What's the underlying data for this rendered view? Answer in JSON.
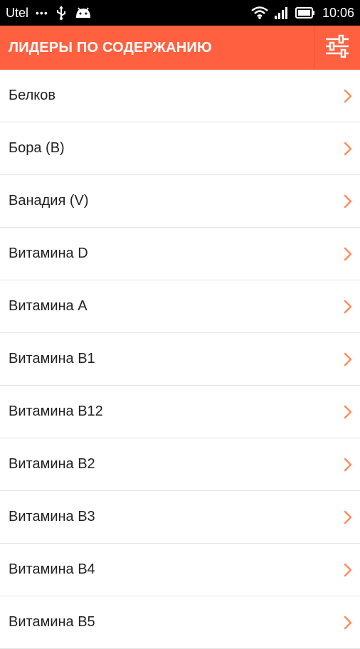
{
  "status_bar": {
    "carrier": "Utel",
    "dots": "•••",
    "time": "10:06",
    "icons": [
      "usb-icon",
      "android-icon",
      "wifi-icon",
      "signal-icon",
      "battery-icon"
    ]
  },
  "app_bar": {
    "title": "ЛИДЕРЫ ПО СОДЕРЖАНИЮ",
    "background": "#ff6140",
    "action_icon": "sliders-icon"
  },
  "list": {
    "items": [
      {
        "label": "Белков"
      },
      {
        "label": "Бора (B)"
      },
      {
        "label": "Ванадия (V)"
      },
      {
        "label": "Витамина D"
      },
      {
        "label": "Витамина А"
      },
      {
        "label": "Витамина В1"
      },
      {
        "label": "Витамина В12"
      },
      {
        "label": "Витамина В2"
      },
      {
        "label": "Витамина В3"
      },
      {
        "label": "Витамина В4"
      },
      {
        "label": "Витамина В5"
      }
    ],
    "chevron_color": "#ff8c5a"
  }
}
